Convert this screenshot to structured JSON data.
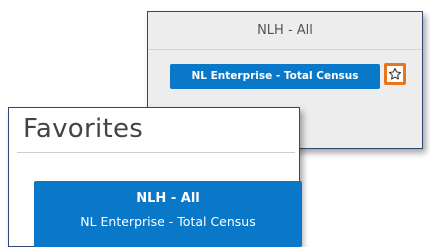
{
  "back_panel": {
    "header": "NLH - All",
    "report_button": "NL Enterprise - Total Census",
    "star_icon": "star-outline-icon",
    "highlight_color": "#e8741c"
  },
  "favorites_panel": {
    "title": "Favorites",
    "items": [
      {
        "title": "NLH - All",
        "subtitle": "NL Enterprise - Total Census"
      }
    ]
  },
  "colors": {
    "accent": "#0a78c8",
    "panel_border": "#2d4a73"
  }
}
